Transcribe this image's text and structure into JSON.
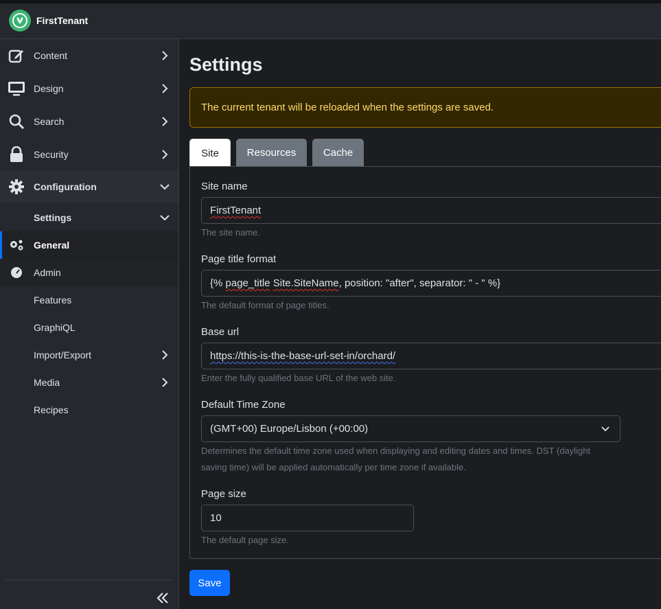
{
  "app": {
    "tenant_name": "FirstTenant"
  },
  "sidebar": {
    "items": [
      {
        "label": "Content",
        "icon": "pen-to-square-icon"
      },
      {
        "label": "Design",
        "icon": "monitor-icon"
      },
      {
        "label": "Search",
        "icon": "search-icon"
      },
      {
        "label": "Security",
        "icon": "lock-icon"
      },
      {
        "label": "Configuration",
        "icon": "gear-icon"
      }
    ],
    "settings_label": "Settings",
    "sub_items": [
      {
        "label": "General",
        "icon": "gears-icon"
      },
      {
        "label": "Admin",
        "icon": "gauge-icon"
      },
      {
        "label": "Features"
      },
      {
        "label": "GraphiQL"
      },
      {
        "label": "Import/Export"
      },
      {
        "label": "Media"
      },
      {
        "label": "Recipes"
      }
    ],
    "collapse_icon": "double-chevron-left-icon"
  },
  "main": {
    "title": "Settings",
    "alert": "The current tenant will be reloaded when the settings are saved.",
    "tabs": [
      {
        "label": "Site",
        "active": true
      },
      {
        "label": "Resources",
        "active": false
      },
      {
        "label": "Cache",
        "active": false
      }
    ],
    "form": {
      "site_name": {
        "label": "Site name",
        "value": "FirstTenant",
        "hint": "The site name."
      },
      "page_title_format": {
        "label": "Page title format",
        "value_part1": "{% ",
        "value_part2": "page_title",
        "value_part3": " ",
        "value_part4": "Site.SiteName",
        "value_part5": ", position: \"after\", separator: \" - \" %}",
        "hint": "The default format of page titles."
      },
      "base_url": {
        "label": "Base url",
        "value": "https://this-is-the-base-url-set-in/orchard/",
        "hint": "Enter the fully qualified base URL of the web site."
      },
      "time_zone": {
        "label": "Default Time Zone",
        "value": "(GMT+00) Europe/Lisbon (+00:00)",
        "hint_line1": "Determines the default time zone used when displaying and editing dates and times. DST (daylight",
        "hint_line2": "saving time) will be applied automatically per time zone if available."
      },
      "page_size": {
        "label": "Page size",
        "value": "10",
        "hint": "The default page size."
      }
    },
    "save_label": "Save"
  },
  "colors": {
    "accent": "#0d6efd",
    "warning_bg": "#332701",
    "warning_text": "#ffda6a",
    "logo": "#3bb273"
  }
}
